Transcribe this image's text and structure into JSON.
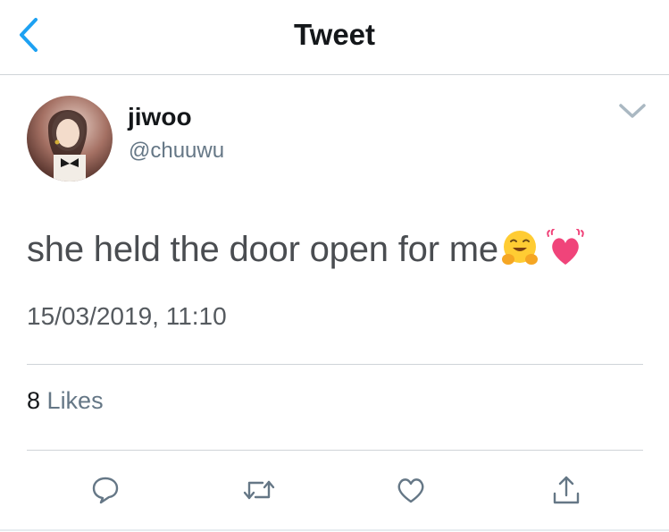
{
  "nav": {
    "title": "Tweet",
    "back_icon": "chevron-left-icon"
  },
  "tweet": {
    "author_name": "jiwoo",
    "author_handle": "@chuuwu",
    "text": "she held the door open for me",
    "emojis": [
      "hugging-face-emoji",
      "beating-heart-emoji"
    ],
    "timestamp": "15/03/2019, 11:10",
    "likes_count": "8",
    "likes_label": "Likes"
  },
  "actions": [
    "reply-icon",
    "retweet-icon",
    "like-icon",
    "share-icon"
  ],
  "colors": {
    "accent": "#1da1f2",
    "icon_gray": "#657786",
    "divider": "#cfd4d8",
    "heart_pink": "#f0447a"
  }
}
